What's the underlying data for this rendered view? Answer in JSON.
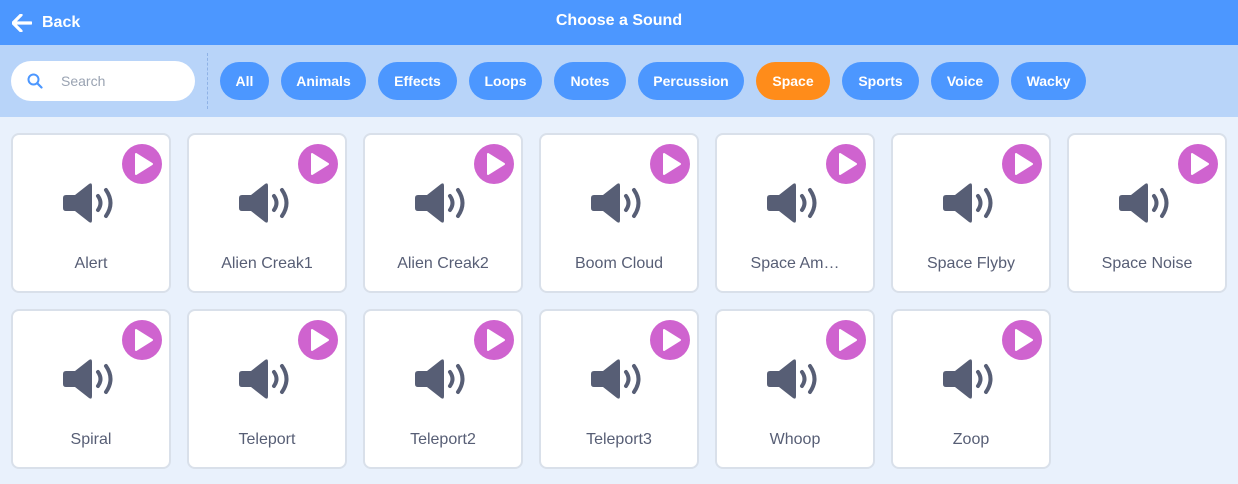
{
  "header": {
    "back_label": "Back",
    "title": "Choose a Sound"
  },
  "search": {
    "placeholder": "Search",
    "value": ""
  },
  "tags": [
    {
      "label": "All",
      "active": false
    },
    {
      "label": "Animals",
      "active": false
    },
    {
      "label": "Effects",
      "active": false
    },
    {
      "label": "Loops",
      "active": false
    },
    {
      "label": "Notes",
      "active": false
    },
    {
      "label": "Percussion",
      "active": false
    },
    {
      "label": "Space",
      "active": true
    },
    {
      "label": "Sports",
      "active": false
    },
    {
      "label": "Voice",
      "active": false
    },
    {
      "label": "Wacky",
      "active": false
    }
  ],
  "sounds": [
    {
      "name": "Alert"
    },
    {
      "name": "Alien Creak1"
    },
    {
      "name": "Alien Creak2"
    },
    {
      "name": "Boom Cloud"
    },
    {
      "name": "Space Am…"
    },
    {
      "name": "Space Flyby"
    },
    {
      "name": "Space Noise"
    },
    {
      "name": "Spiral"
    },
    {
      "name": "Teleport"
    },
    {
      "name": "Teleport2"
    },
    {
      "name": "Teleport3"
    },
    {
      "name": "Whoop"
    },
    {
      "name": "Zoop"
    }
  ],
  "icons": {
    "back": "arrow-left-icon",
    "search": "search-icon",
    "sound": "speaker-icon",
    "play": "play-icon"
  },
  "colors": {
    "header": "#4c97ff",
    "filterbar": "#b8d4f9",
    "tag": "#4c97ff",
    "tag_active": "#ff8c1a",
    "play": "#cf63cf",
    "speaker": "#575e75",
    "background": "#e9f1fc"
  }
}
